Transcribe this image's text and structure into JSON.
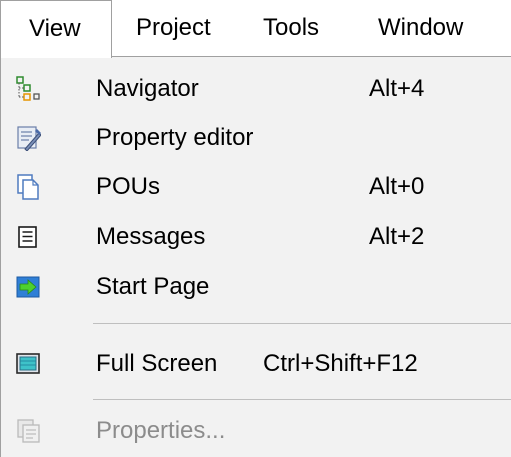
{
  "menubar": {
    "items": [
      {
        "label": "View"
      },
      {
        "label": "Project"
      },
      {
        "label": "Tools"
      },
      {
        "label": "Window"
      }
    ]
  },
  "view_menu": {
    "items": [
      {
        "label": "Navigator",
        "shortcut": "Alt+4",
        "icon": "navigator-tree-icon",
        "enabled": true
      },
      {
        "label": "Property editor",
        "shortcut": "",
        "icon": "property-editor-icon",
        "enabled": true
      },
      {
        "label": "POUs",
        "shortcut": "Alt+0",
        "icon": "pous-document-icon",
        "enabled": true
      },
      {
        "label": "Messages",
        "shortcut": "Alt+2",
        "icon": "messages-icon",
        "enabled": true
      },
      {
        "label": "Start Page",
        "shortcut": "",
        "icon": "start-page-arrow-icon",
        "enabled": true
      },
      {
        "label": "Full Screen",
        "shortcut": "Ctrl+Shift+F12",
        "icon": "full-screen-icon",
        "enabled": true
      },
      {
        "label": "Properties...",
        "shortcut": "",
        "icon": "properties-icon",
        "enabled": false
      }
    ]
  },
  "colors": {
    "menu_background": "#f2f2f2",
    "menubar_background": "#ffffff",
    "border": "#a0a0a0",
    "separator": "#bfbfbf",
    "disabled_text": "#8c8c8c",
    "text": "#000000"
  }
}
